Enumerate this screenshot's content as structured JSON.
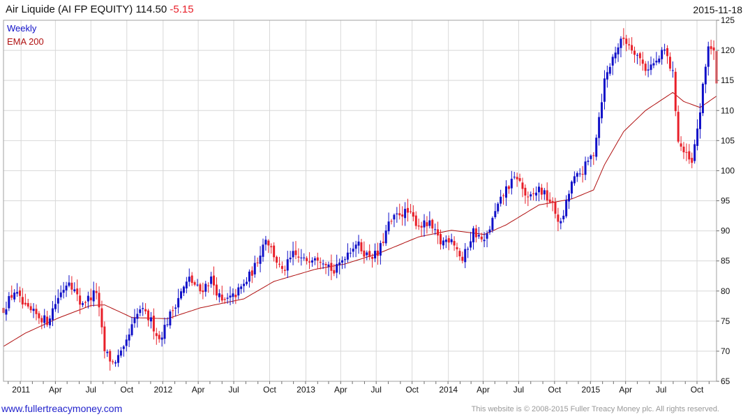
{
  "header": {
    "title": "Air Liquide (AI FP EQUITY) 114.50",
    "change": "-5.15",
    "date": "2015-11-18"
  },
  "legend": {
    "weekly_label": "Weekly",
    "ema_label": "EMA 200",
    "weekly_color": "#1010c8",
    "ema_color": "#b01010"
  },
  "footer": {
    "site": "www.fullertreacymoney.com",
    "copyright": "This website is © 2008-2015 Fuller Treacy Money plc. All rights reserved."
  },
  "colors": {
    "up": "#1010c8",
    "down": "#e8202a",
    "grid": "#d8d8d8",
    "ema": "#b01010"
  },
  "chart_data": {
    "type": "candlestick",
    "frequency": "weekly",
    "x_range": [
      "2010-11-19",
      "2015-11-20"
    ],
    "ylim": [
      65,
      125
    ],
    "y_ticks": [
      65,
      70,
      75,
      80,
      85,
      90,
      95,
      100,
      105,
      110,
      115,
      120,
      125
    ],
    "x_ticks": [
      {
        "label": "2011",
        "date": "2011-01-03"
      },
      {
        "label": "Apr",
        "date": "2011-04-01"
      },
      {
        "label": "Jul",
        "date": "2011-07-01"
      },
      {
        "label": "Oct",
        "date": "2011-10-01"
      },
      {
        "label": "2012",
        "date": "2012-01-02"
      },
      {
        "label": "Apr",
        "date": "2012-04-01"
      },
      {
        "label": "Jul",
        "date": "2012-07-01"
      },
      {
        "label": "Oct",
        "date": "2012-10-01"
      },
      {
        "label": "2013",
        "date": "2013-01-02"
      },
      {
        "label": "Apr",
        "date": "2013-04-01"
      },
      {
        "label": "Jul",
        "date": "2013-07-01"
      },
      {
        "label": "Oct",
        "date": "2013-10-01"
      },
      {
        "label": "2014",
        "date": "2014-01-02"
      },
      {
        "label": "Apr",
        "date": "2014-04-01"
      },
      {
        "label": "Jul",
        "date": "2014-07-01"
      },
      {
        "label": "Oct",
        "date": "2014-10-01"
      },
      {
        "label": "2015",
        "date": "2015-01-02"
      },
      {
        "label": "Apr",
        "date": "2015-04-01"
      },
      {
        "label": "Jul",
        "date": "2015-07-01"
      },
      {
        "label": "Oct",
        "date": "2015-10-01"
      }
    ],
    "close_path": [
      [
        "2010-11-19",
        77
      ],
      [
        "2010-12-17",
        80
      ],
      [
        "2011-01-14",
        77
      ],
      [
        "2011-02-11",
        76
      ],
      [
        "2011-03-11",
        75
      ],
      [
        "2011-04-08",
        79
      ],
      [
        "2011-05-06",
        82
      ],
      [
        "2011-06-03",
        78
      ],
      [
        "2011-07-01",
        79
      ],
      [
        "2011-07-15",
        80
      ],
      [
        "2011-08-05",
        70
      ],
      [
        "2011-08-26",
        68
      ],
      [
        "2011-09-23",
        70
      ],
      [
        "2011-10-14",
        74
      ],
      [
        "2011-11-04",
        77
      ],
      [
        "2011-12-02",
        75
      ],
      [
        "2011-12-23",
        72
      ],
      [
        "2012-01-13",
        75
      ],
      [
        "2012-02-10",
        79
      ],
      [
        "2012-03-09",
        82
      ],
      [
        "2012-04-06",
        80
      ],
      [
        "2012-05-04",
        82
      ],
      [
        "2012-06-01",
        78
      ],
      [
        "2012-06-29",
        79
      ],
      [
        "2012-07-27",
        81
      ],
      [
        "2012-08-24",
        84
      ],
      [
        "2012-09-21",
        89
      ],
      [
        "2012-10-12",
        86
      ],
      [
        "2012-11-02",
        83
      ],
      [
        "2012-11-30",
        86
      ],
      [
        "2012-12-28",
        85
      ],
      [
        "2013-01-25",
        86
      ],
      [
        "2013-02-22",
        85
      ],
      [
        "2013-03-15",
        83
      ],
      [
        "2013-04-12",
        86
      ],
      [
        "2013-05-10",
        88
      ],
      [
        "2013-06-07",
        86
      ],
      [
        "2013-07-05",
        86
      ],
      [
        "2013-08-02",
        91
      ],
      [
        "2013-08-30",
        93
      ],
      [
        "2013-09-20",
        93
      ],
      [
        "2013-10-18",
        91
      ],
      [
        "2013-11-15",
        91
      ],
      [
        "2013-12-13",
        88
      ],
      [
        "2014-01-10",
        89
      ],
      [
        "2014-02-07",
        85
      ],
      [
        "2014-03-07",
        90
      ],
      [
        "2014-04-04",
        88
      ],
      [
        "2014-05-02",
        93
      ],
      [
        "2014-05-30",
        97
      ],
      [
        "2014-06-27",
        99
      ],
      [
        "2014-07-25",
        95
      ],
      [
        "2014-08-22",
        97
      ],
      [
        "2014-09-19",
        95
      ],
      [
        "2014-10-17",
        91
      ],
      [
        "2014-11-14",
        98
      ],
      [
        "2014-12-12",
        100
      ],
      [
        "2015-01-09",
        103
      ],
      [
        "2015-02-06",
        115
      ],
      [
        "2015-03-06",
        120
      ],
      [
        "2015-03-27",
        122
      ],
      [
        "2015-04-24",
        120
      ],
      [
        "2015-05-22",
        117
      ],
      [
        "2015-06-19",
        118
      ],
      [
        "2015-07-10",
        120
      ],
      [
        "2015-07-31",
        116
      ],
      [
        "2015-08-14",
        105
      ],
      [
        "2015-08-28",
        103
      ],
      [
        "2015-09-18",
        101
      ],
      [
        "2015-10-09",
        110
      ],
      [
        "2015-10-30",
        121
      ],
      [
        "2015-11-13",
        119.65
      ],
      [
        "2015-11-20",
        114.5
      ]
    ],
    "ema_path": [
      [
        "2010-11-19",
        70.8
      ],
      [
        "2011-01-14",
        73.0
      ],
      [
        "2011-04-08",
        75.5
      ],
      [
        "2011-07-01",
        77.6
      ],
      [
        "2011-08-05",
        77.7
      ],
      [
        "2011-10-14",
        75.6
      ],
      [
        "2012-01-13",
        75.4
      ],
      [
        "2012-04-06",
        77.2
      ],
      [
        "2012-07-27",
        78.7
      ],
      [
        "2012-10-12",
        81.6
      ],
      [
        "2013-01-25",
        83.6
      ],
      [
        "2013-04-12",
        84.5
      ],
      [
        "2013-07-05",
        86.2
      ],
      [
        "2013-10-18",
        89.0
      ],
      [
        "2014-01-10",
        90.1
      ],
      [
        "2014-04-04",
        89.4
      ],
      [
        "2014-05-30",
        91.0
      ],
      [
        "2014-08-22",
        94.3
      ],
      [
        "2014-11-14",
        95.3
      ],
      [
        "2015-01-09",
        96.8
      ],
      [
        "2015-02-06",
        101.0
      ],
      [
        "2015-03-27",
        106.5
      ],
      [
        "2015-05-22",
        110.0
      ],
      [
        "2015-07-31",
        113.0
      ],
      [
        "2015-08-28",
        111.5
      ],
      [
        "2015-10-09",
        110.5
      ],
      [
        "2015-11-20",
        112.4
      ]
    ]
  }
}
